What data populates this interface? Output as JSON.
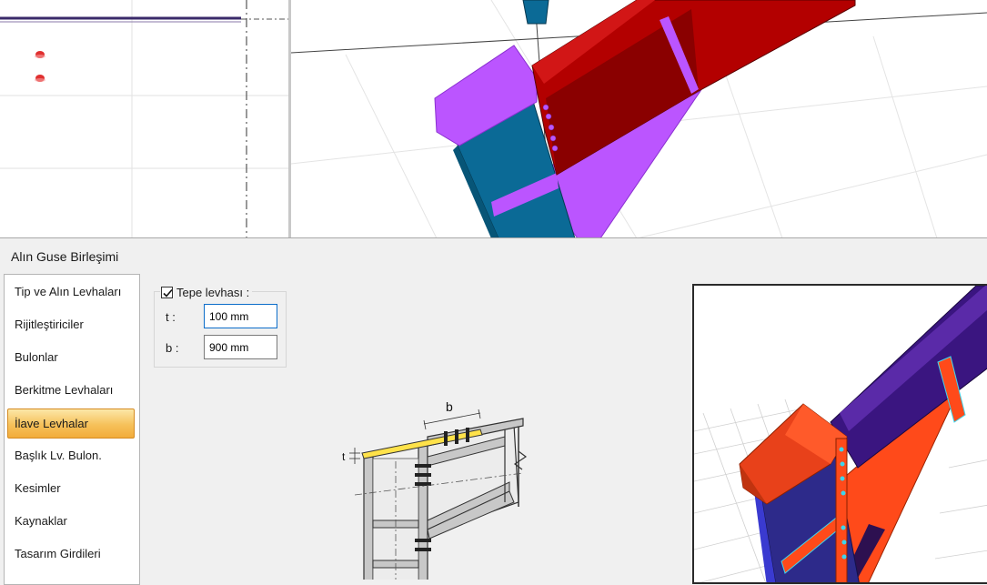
{
  "dialog": {
    "title": "Alın Guse Birleşimi"
  },
  "nav": {
    "items": [
      {
        "label": "Tip ve Alın Levhaları",
        "selected": false
      },
      {
        "label": "Rijitleştiriciler",
        "selected": false
      },
      {
        "label": "Bulonlar",
        "selected": false
      },
      {
        "label": "Berkitme Levhaları",
        "selected": false
      },
      {
        "label": "İlave Levhalar",
        "selected": true
      },
      {
        "label": "Başlık Lv. Bulon.",
        "selected": false
      },
      {
        "label": "Kesimler",
        "selected": false
      },
      {
        "label": "Kaynaklar",
        "selected": false
      },
      {
        "label": "Tasarım Girdileri",
        "selected": false
      }
    ]
  },
  "top_plate": {
    "label": "Tepe levhası :",
    "checked": true,
    "t_label": "t :",
    "t_value": "100 mm",
    "b_label": "b :",
    "b_value": "900 mm"
  },
  "schematic": {
    "dim_b": "b",
    "dim_t": "t"
  },
  "colors": {
    "selection": "#f6c15a",
    "beam_red": "#b30000",
    "column_blue": "#0a6590",
    "plate_purple": "#bb55ff",
    "preview_beam_purple": "#3a1580",
    "preview_plate_orange": "#ff4a1a"
  }
}
